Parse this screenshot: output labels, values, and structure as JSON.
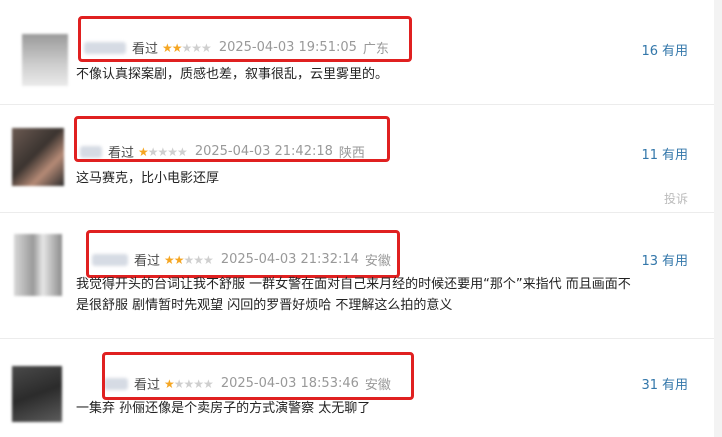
{
  "comments": [
    {
      "watched": "看过",
      "rating": 2,
      "time": "2025-04-03 19:51:05",
      "location": "广东",
      "votes": "16",
      "useful": "有用",
      "text": "不像认真探案剧，质感也差，叙事很乱，云里雾里的。"
    },
    {
      "watched": "看过",
      "rating": 1,
      "time": "2025-04-03 21:42:18",
      "location": "陕西",
      "votes": "11",
      "useful": "有用",
      "text": "这马赛克，比小电影还厚",
      "report": "投诉"
    },
    {
      "watched": "看过",
      "rating": 2,
      "time": "2025-04-03 21:32:14",
      "location": "安徽",
      "votes": "13",
      "useful": "有用",
      "text": "我觉得开头的台词让我不舒服 一群女警在面对自己来月经的时候还要用“那个”来指代 而且画面不是很舒服 剧情暂时先观望 闪回的罗晋好烦哈 不理解这么拍的意义"
    },
    {
      "watched": "看过",
      "rating": 1,
      "time": "2025-04-03 18:53:46",
      "location": "安徽",
      "votes": "31",
      "useful": "有用",
      "text": "一集弃 孙俪还像是个卖房子的方式演警察 太无聊了"
    }
  ],
  "colors": {
    "highlight_box": "#e02020",
    "star_on": "#f5a623",
    "link": "#3377aa"
  }
}
